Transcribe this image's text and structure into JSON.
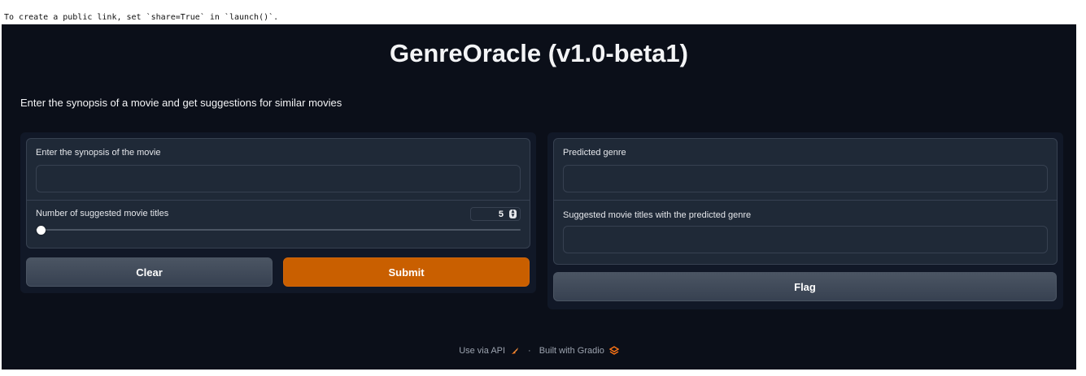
{
  "console": {
    "text": "To create a public link, set `share=True` in `launch()`."
  },
  "app": {
    "title": "GenreOracle (v1.0-beta1)",
    "description": "Enter the synopsis of a movie and get suggestions for similar movies"
  },
  "inputs": {
    "synopsis_label": "Enter the synopsis of the movie",
    "synopsis_value": "",
    "num_titles_label": "Number of suggested movie titles",
    "num_titles_value": "5"
  },
  "outputs": {
    "genre_label": "Predicted genre",
    "genre_value": "",
    "titles_label": "Suggested movie titles with the predicted genre",
    "titles_value": ""
  },
  "buttons": {
    "clear": "Clear",
    "submit": "Submit",
    "flag": "Flag"
  },
  "footer": {
    "api_link": "Use via API",
    "separator": "·",
    "built_with": "Built with Gradio"
  },
  "colors": {
    "background": "#0b0f19",
    "panel": "#1f2937",
    "primary": "#c95f00"
  }
}
